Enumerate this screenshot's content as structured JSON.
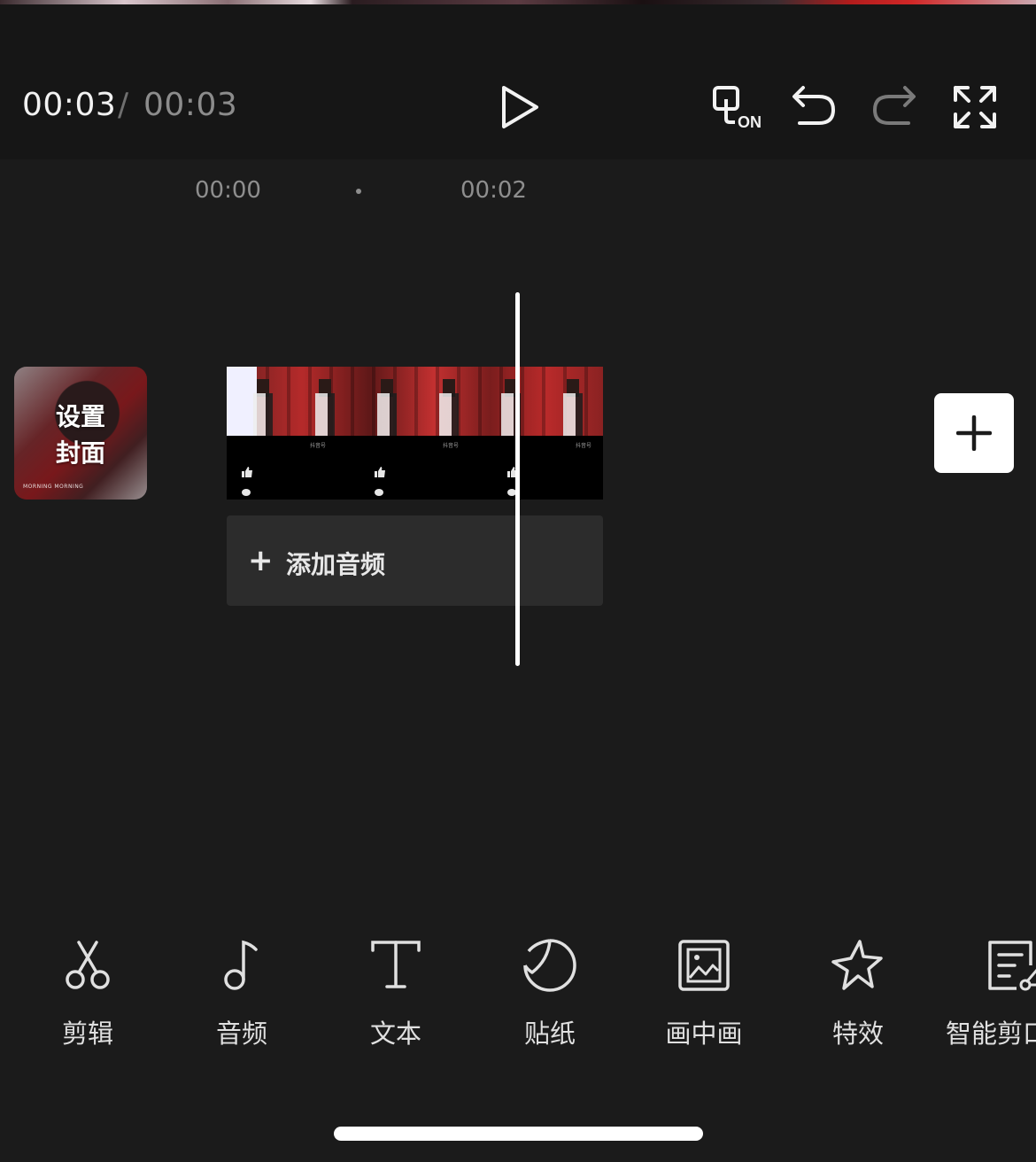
{
  "player": {
    "current_time": "00:03",
    "separator": "/",
    "total_time": "00:03"
  },
  "ruler": {
    "marks": [
      "00:00",
      "00:02"
    ]
  },
  "cover": {
    "label": "设置\n封面",
    "small_text": "MORNING MORNING"
  },
  "clip": {
    "stamp": "抖音号"
  },
  "audio_track": {
    "plus": "+",
    "label": "添加音频"
  },
  "toolbar": {
    "items": [
      {
        "label": "剪辑",
        "icon": "scissors-icon"
      },
      {
        "label": "音频",
        "icon": "music-note-icon"
      },
      {
        "label": "文本",
        "icon": "text-icon"
      },
      {
        "label": "贴纸",
        "icon": "sticker-icon"
      },
      {
        "label": "画中画",
        "icon": "picture-in-picture-icon"
      },
      {
        "label": "特效",
        "icon": "star-effect-icon"
      },
      {
        "label": "智能剪口",
        "icon": "smart-cut-icon"
      }
    ]
  },
  "colors": {
    "background": "#1b1b1b",
    "player_bar": "#161616",
    "accent": "#ffffff",
    "muted_text": "#8c8c8c"
  }
}
